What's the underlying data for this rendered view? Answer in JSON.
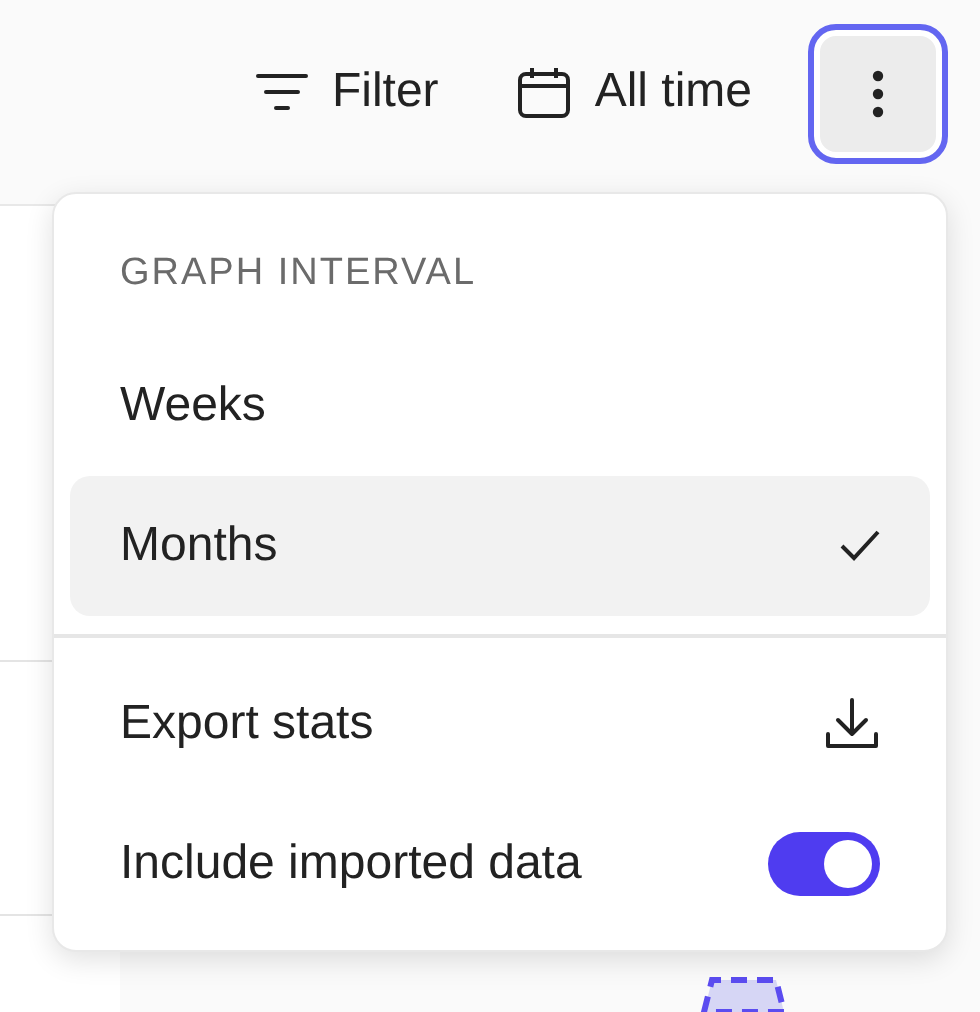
{
  "toolbar": {
    "filter_button": "Filter",
    "date_button": "All time",
    "more_button": {
      "focused": true
    }
  },
  "menu": {
    "section_label": "GRAPH INTERVAL",
    "intervals": [
      {
        "label": "Weeks",
        "selected": false
      },
      {
        "label": "Months",
        "selected": true
      }
    ],
    "actions": [
      {
        "kind": "export",
        "label": "Export stats"
      },
      {
        "kind": "toggle",
        "label": "Include imported data",
        "on": true
      }
    ]
  }
}
